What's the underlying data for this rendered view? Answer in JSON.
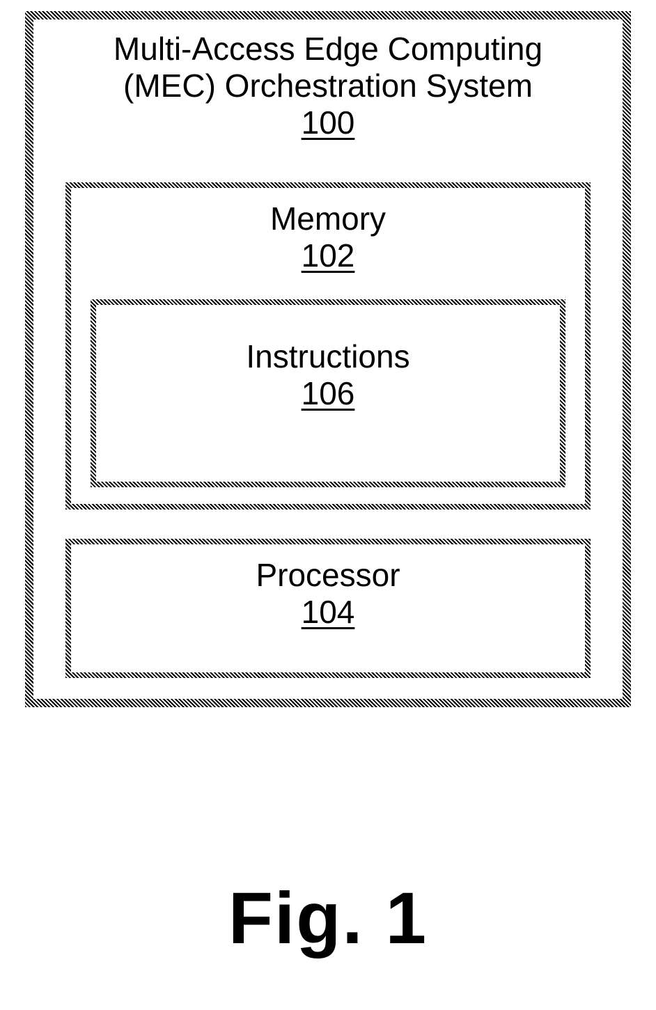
{
  "diagram": {
    "system": {
      "title_line1": "Multi-Access Edge Computing",
      "title_line2": "(MEC) Orchestration System",
      "ref": "100"
    },
    "memory": {
      "title": "Memory",
      "ref": "102"
    },
    "instructions": {
      "title": "Instructions",
      "ref": "106"
    },
    "processor": {
      "title": "Processor",
      "ref": "104"
    },
    "figure_label": "Fig. 1"
  }
}
